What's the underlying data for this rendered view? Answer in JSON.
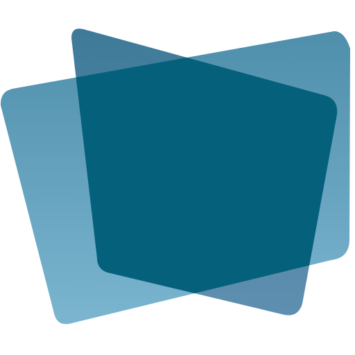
{
  "logo": {
    "back_shape_colors": {
      "top": "#4f8fab",
      "bottom": "#7bb5d0"
    },
    "front_shape_colors": {
      "top": "#3f7a99",
      "bottom": "#5f8fb0"
    },
    "overlap_color": "#05607c"
  }
}
